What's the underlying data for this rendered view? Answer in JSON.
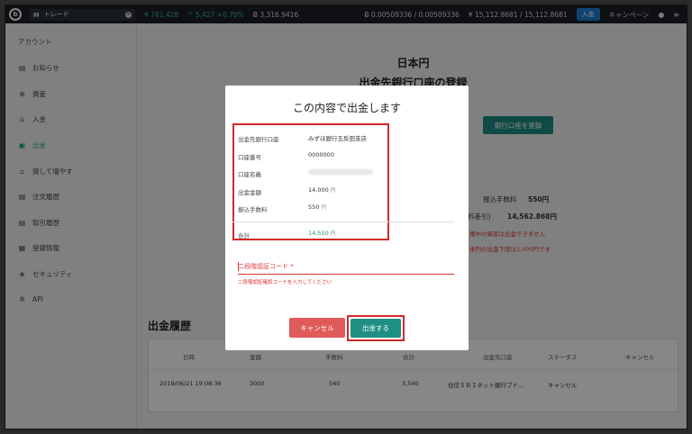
{
  "topbar": {
    "logo": "b",
    "trade_label": "トレード",
    "yen_balance": "¥ 781,428",
    "change": "^ 5,427 +0.70%",
    "btc_balance": "Ƀ 3,316.9416",
    "btc_rate": "Ƀ 0.00509336 / 0.00509336",
    "yen_rate": "¥ 15,112.8681 / 15,112.8681",
    "deposit": "入金",
    "campaign": "キャンペーン"
  },
  "sidebar": {
    "title": "アカウント",
    "items": [
      {
        "label": "お知らせ",
        "icon": "message-icon"
      },
      {
        "label": "資産",
        "icon": "plus-circle-icon"
      },
      {
        "label": "入金",
        "icon": "bank-icon"
      },
      {
        "label": "出金",
        "icon": "withdraw-icon"
      },
      {
        "label": "貸して増やす",
        "icon": "bank-icon"
      },
      {
        "label": "注文履歴",
        "icon": "list-icon"
      },
      {
        "label": "取引履歴",
        "icon": "history-icon"
      },
      {
        "label": "登録情報",
        "icon": "id-icon"
      },
      {
        "label": "セキュリティ",
        "icon": "shield-icon"
      },
      {
        "label": "API",
        "icon": "gear-icon"
      }
    ]
  },
  "main": {
    "currency_title": "日本円",
    "section_title": "出金先銀行口座の登録",
    "register_bank": "銀行口座を登録",
    "fee_label": "振込手数料",
    "fee_value": "550円",
    "net_label": "料差引)",
    "net_value": "14,562.868円",
    "warn1": "用中の資産は出金できません",
    "warn2": "本円の出金下限は1,000円です"
  },
  "history": {
    "title": "出金履歴",
    "headers": [
      "日時",
      "金額",
      "手数料",
      "合計",
      "出金先口座",
      "ステータス",
      "キャンセル"
    ],
    "rows": [
      [
        "2019/06/21 19:08:36",
        "3000",
        "540",
        "3,540",
        "住信ＳＢＩネット銀行ブド...",
        "キャンセル",
        ""
      ]
    ]
  },
  "modal": {
    "title": "この内容で出金します",
    "rows": [
      {
        "label": "出金先銀行口座",
        "value": "みずほ銀行五反田支店"
      },
      {
        "label": "口座番号",
        "value": "0000000"
      },
      {
        "label": "口座名義",
        "value": ""
      },
      {
        "label": "出金金額",
        "value": "14,000",
        "unit": "円"
      },
      {
        "label": "振込手数料",
        "value": "550",
        "unit": "円"
      }
    ],
    "total_label": "合計",
    "total_value": "14,550",
    "total_unit": "円",
    "otp_label": "二段階認証コード *",
    "otp_help": "二段階認証確認コードを入力してください",
    "cancel": "キャンセル",
    "submit": "出金する"
  }
}
